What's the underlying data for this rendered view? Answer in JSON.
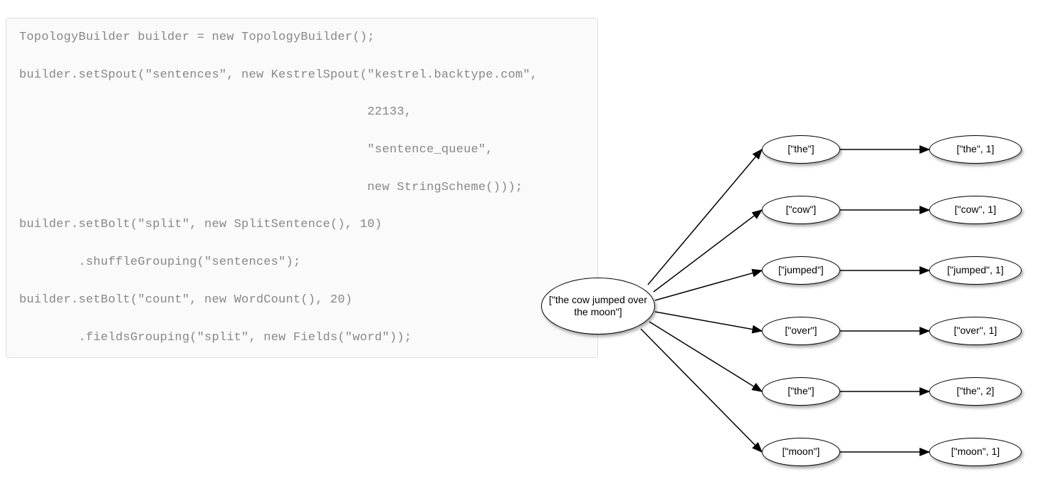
{
  "code": {
    "l1": "TopologyBuilder builder = new TopologyBuilder();",
    "l2": "builder.setSpout(\"sentences\", new KestrelSpout(\"kestrel.backtype.com\",",
    "l3": "                                               22133,",
    "l4": "                                               \"sentence_queue\",",
    "l5": "                                               new StringScheme()));",
    "l6": "builder.setBolt(\"split\", new SplitSentence(), 10)",
    "l7": "        .shuffleGrouping(\"sentences\");",
    "l8": "builder.setBolt(\"count\", new WordCount(), 20)",
    "l9": "        .fieldsGrouping(\"split\", new Fields(\"word\"));"
  },
  "diagram": {
    "root": "[\"the cow jumped over the moon\"]",
    "mid": [
      "[\"the\"]",
      "[\"cow\"]",
      "[\"jumped\"]",
      "[\"over\"]",
      "[\"the\"]",
      "[\"moon\"]"
    ],
    "leaf": [
      "[\"the\", 1]",
      "[\"cow\", 1]",
      "[\"jumped\", 1]",
      "[\"over\", 1]",
      "[\"the\", 2]",
      "[\"moon\", 1]"
    ]
  }
}
